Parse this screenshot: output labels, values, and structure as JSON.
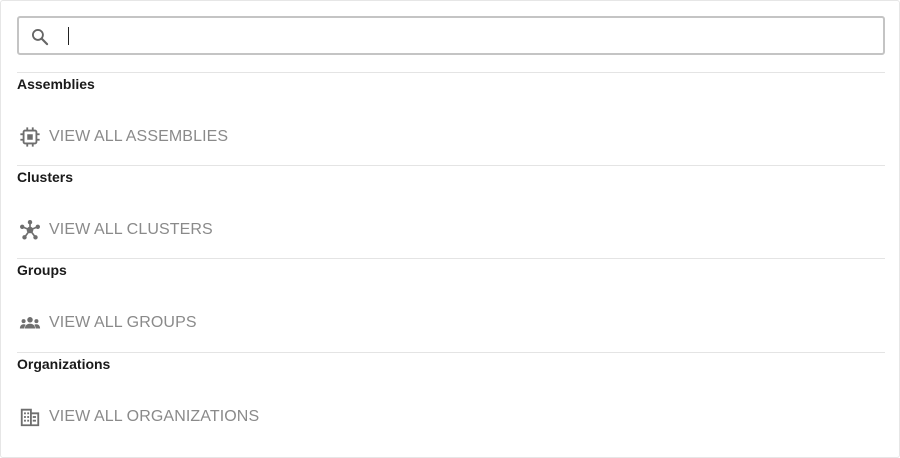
{
  "search": {
    "value": "",
    "icon": "search-icon"
  },
  "sections": [
    {
      "title": "Assemblies",
      "link_label": "VIEW ALL ASSEMBLIES",
      "icon": "chip-icon"
    },
    {
      "title": "Clusters",
      "link_label": "VIEW ALL CLUSTERS",
      "icon": "cluster-icon"
    },
    {
      "title": "Groups",
      "link_label": "VIEW ALL GROUPS",
      "icon": "group-icon"
    },
    {
      "title": "Organizations",
      "link_label": "VIEW ALL ORGANIZATIONS",
      "icon": "building-icon"
    }
  ],
  "colors": {
    "link_text": "#8a8a8a",
    "icon": "#6e6e6e",
    "title_text": "#1a1a1a",
    "divider": "#e4e4e4",
    "search_border": "#c4c4c4"
  }
}
